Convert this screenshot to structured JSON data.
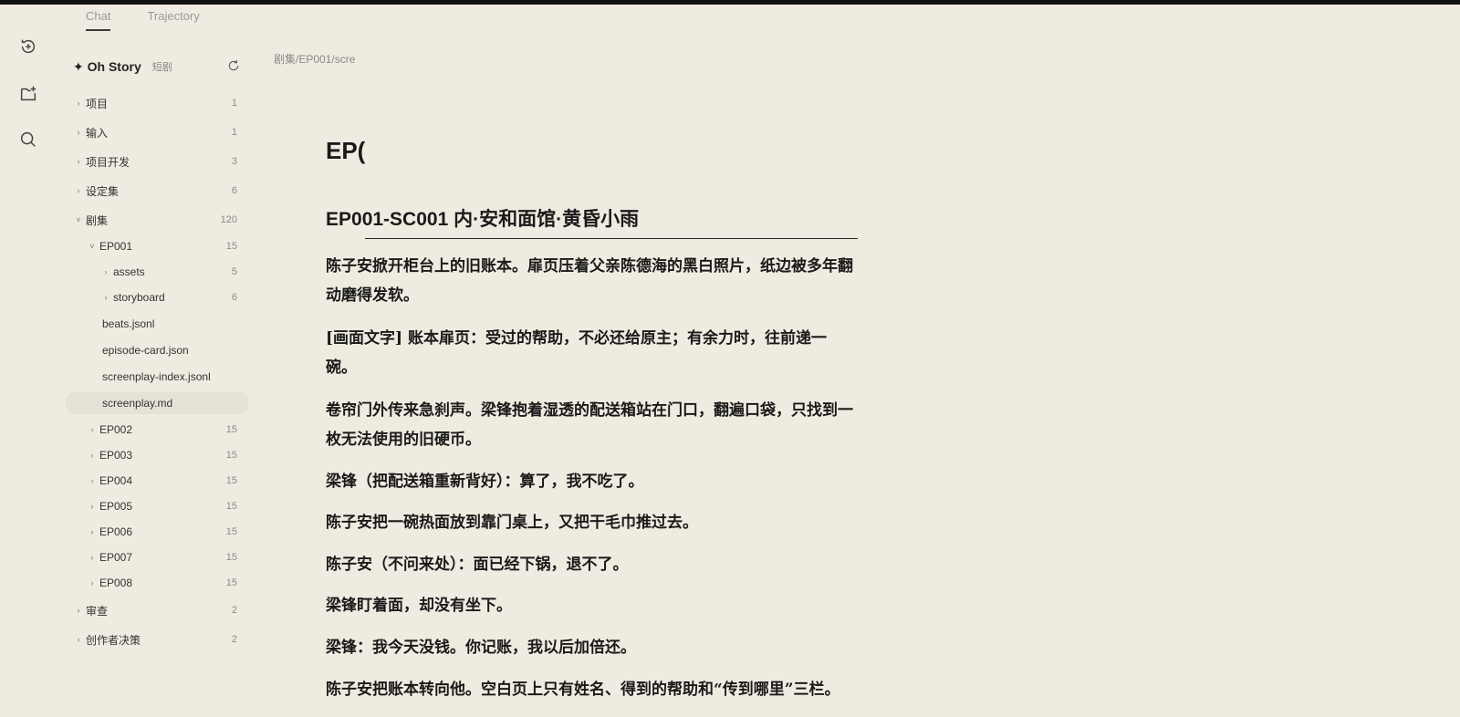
{
  "tabs": [
    {
      "label": "Chat"
    },
    {
      "label": "Trajectory"
    }
  ],
  "sidebar": {
    "brand": "✦ Oh Story",
    "brand_tag": "短剧",
    "tree": [
      {
        "label": "项目",
        "count": "1",
        "level": 0,
        "chevron": "›"
      },
      {
        "label": "输入",
        "count": "1",
        "level": 0,
        "chevron": "›"
      },
      {
        "label": "项目开发",
        "count": "3",
        "level": 0,
        "chevron": "›"
      },
      {
        "label": "设定集",
        "count": "6",
        "level": 0,
        "chevron": "›"
      },
      {
        "label": "剧集",
        "count": "120",
        "level": 0,
        "chevron": "˅"
      },
      {
        "label": "EP001",
        "count": "15",
        "level": 1,
        "chevron": "˅"
      },
      {
        "label": "assets",
        "count": "5",
        "level": 2,
        "chevron": "›"
      },
      {
        "label": "storyboard",
        "count": "6",
        "level": 2,
        "chevron": "›"
      },
      {
        "label": "beats.jsonl",
        "count": "",
        "level": 3,
        "chevron": ""
      },
      {
        "label": "episode-card.json",
        "count": "",
        "level": 3,
        "chevron": ""
      },
      {
        "label": "screenplay-index.jsonl",
        "count": "",
        "level": 3,
        "chevron": ""
      },
      {
        "label": "screenplay.md",
        "count": "",
        "level": 3,
        "chevron": "",
        "selected": true
      },
      {
        "label": "EP002",
        "count": "15",
        "level": 1,
        "chevron": "›"
      },
      {
        "label": "EP003",
        "count": "15",
        "level": 1,
        "chevron": "›"
      },
      {
        "label": "EP004",
        "count": "15",
        "level": 1,
        "chevron": "›"
      },
      {
        "label": "EP005",
        "count": "15",
        "level": 1,
        "chevron": "›"
      },
      {
        "label": "EP006",
        "count": "15",
        "level": 1,
        "chevron": "›"
      },
      {
        "label": "EP007",
        "count": "15",
        "level": 1,
        "chevron": "›"
      },
      {
        "label": "EP008",
        "count": "15",
        "level": 1,
        "chevron": "›"
      },
      {
        "label": "审查",
        "count": "2",
        "level": 0,
        "chevron": "›"
      },
      {
        "label": "创作者决策",
        "count": "2",
        "level": 0,
        "chevron": "›"
      }
    ]
  },
  "main": {
    "breadcrumb": "剧集/EP001/scre",
    "title": "EP(",
    "scene_heading": "EP001-SC001 内·安和面馆·黄昏小雨",
    "paragraphs": [
      "陈子安掀开柜台上的旧账本。扉页压着父亲陈德海的黑白照片，纸边被多年翻动磨得发软。",
      "[画面文字] 账本扉页：受过的帮助，不必还给原主；有余力时，往前递一碗。",
      "卷帘门外传来急刹声。梁锋抱着湿透的配送箱站在门口，翻遍口袋，只找到一枚无法使用的旧硬币。",
      "梁锋（把配送箱重新背好）：算了，我不吃了。",
      "陈子安把一碗热面放到靠门桌上，又把干毛巾推过去。",
      "陈子安（不问来处）：面已经下锅，退不了。",
      "梁锋盯着面，却没有坐下。",
      "梁锋：我今天没钱。你记账，我以后加倍还。",
      "陈子安把账本转向他。空白页上只有姓名、得到的帮助和“传到哪里”三栏。"
    ]
  }
}
